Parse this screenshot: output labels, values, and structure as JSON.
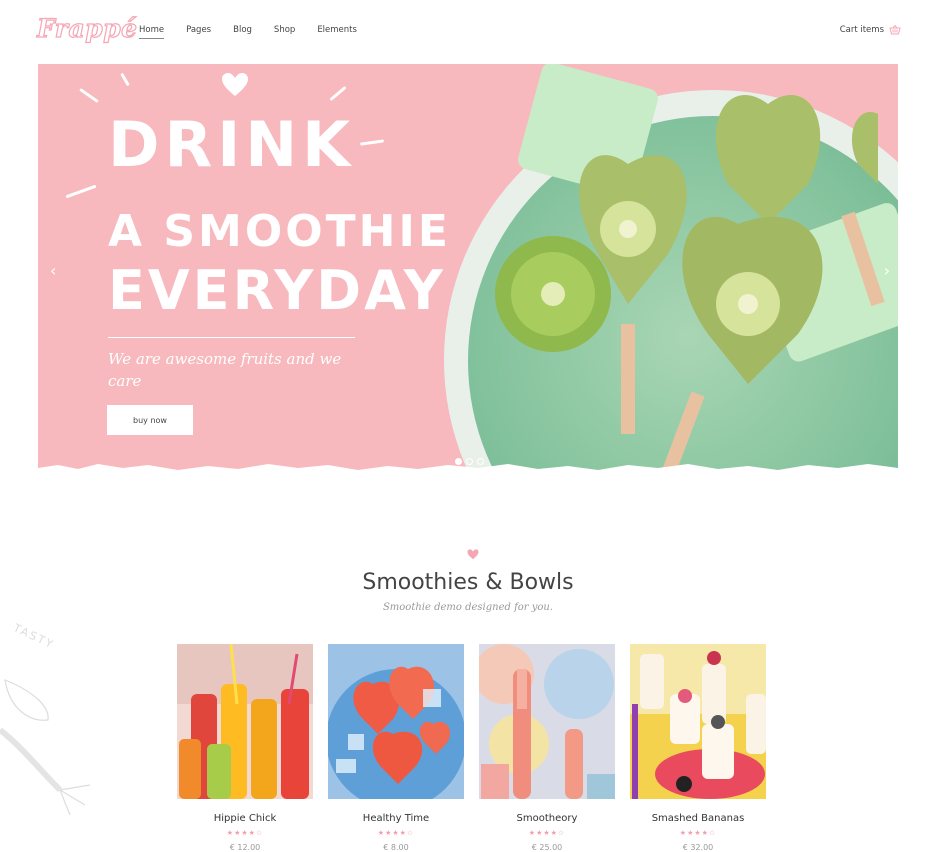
{
  "header": {
    "logo": "Frappé",
    "nav": [
      "Home",
      "Pages",
      "Blog",
      "Shop",
      "Elements"
    ],
    "cart_label": "Cart items"
  },
  "hero": {
    "line1": "DRINK",
    "line2": "A SMOOTHIE",
    "line3": "EVERYDAY",
    "subtitle": "We are awesome fruits and we care",
    "button": "buy now",
    "prev": "‹",
    "next": "›",
    "bg_color": "#f7b9bd"
  },
  "section": {
    "title": "Smoothies & Bowls",
    "subtitle": "Smoothie demo designed for you.",
    "decor_text": "TASTY"
  },
  "products": [
    {
      "name": "Hippie Chick",
      "stars": "★★★★☆",
      "price": "€ 12.00"
    },
    {
      "name": "Healthy Time",
      "stars": "★★★★☆",
      "price": "€ 8.00"
    },
    {
      "name": "Smootheory",
      "stars": "★★★★☆",
      "price": "€ 25.00"
    },
    {
      "name": "Smashed Bananas",
      "stars": "★★★★☆",
      "price": "€ 32.00"
    }
  ],
  "colors": {
    "accent": "#f4a6b3",
    "text": "#333333"
  }
}
